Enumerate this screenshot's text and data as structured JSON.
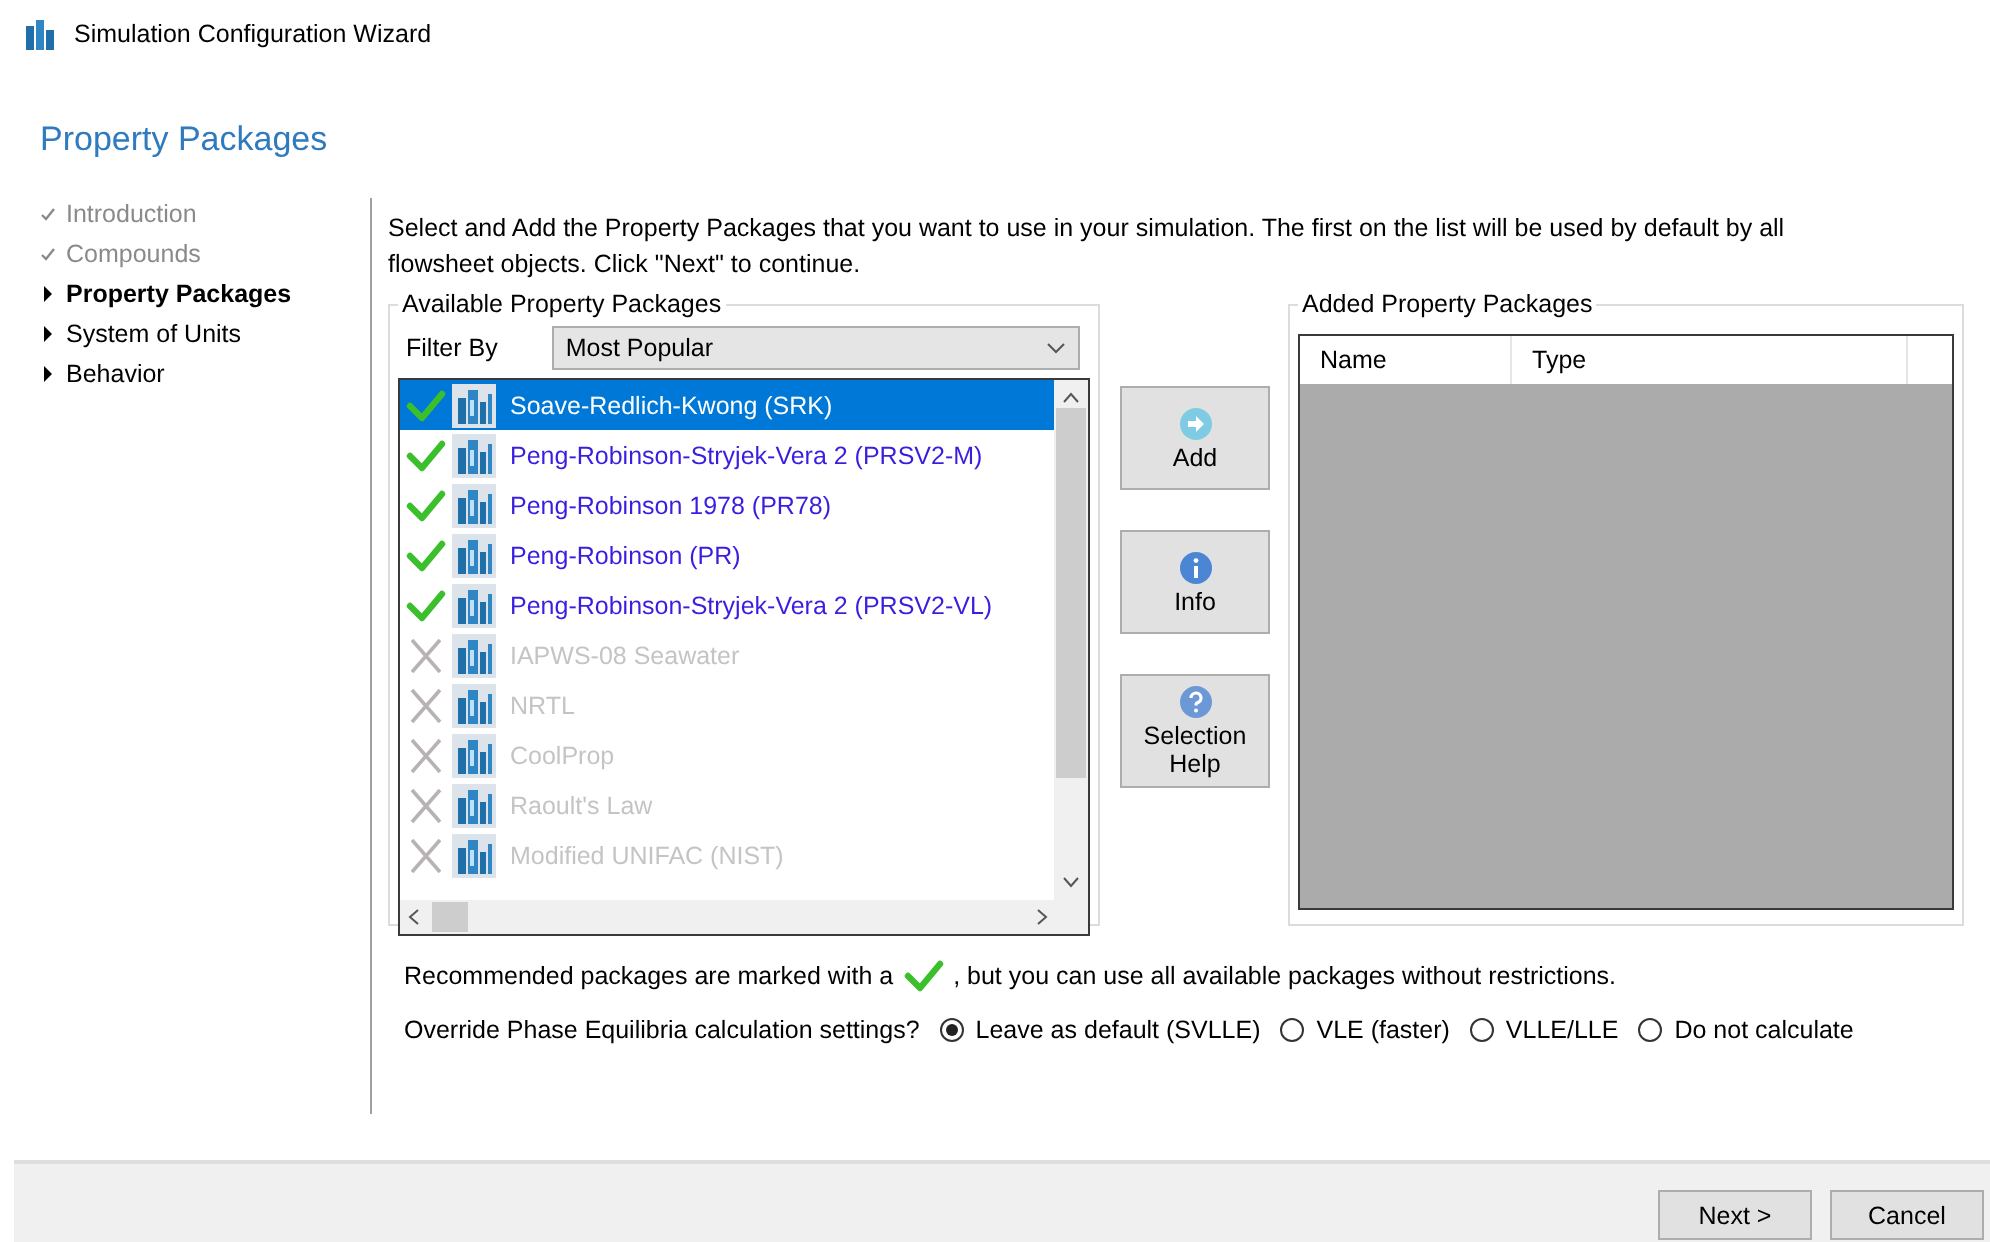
{
  "window": {
    "title": "Simulation Configuration Wizard"
  },
  "heading": "Property Packages",
  "steps": [
    {
      "label": "Introduction",
      "completed": true,
      "selected": false
    },
    {
      "label": "Compounds",
      "completed": true,
      "selected": false
    },
    {
      "label": "Property Packages",
      "completed": false,
      "selected": true
    },
    {
      "label": "System of Units",
      "completed": false,
      "selected": false
    },
    {
      "label": "Behavior",
      "completed": false,
      "selected": false
    }
  ],
  "description": "Select and Add the Property Packages that you want to use in your simulation. The first on the list will be used by default by all flowsheet objects. Click \"Next\" to continue.",
  "available": {
    "title": "Available Property Packages",
    "filter_label": "Filter By",
    "filter_value": "Most Popular",
    "packages": [
      {
        "name": "Soave-Redlich-Kwong (SRK)",
        "recommended": true,
        "selected": true
      },
      {
        "name": "Peng-Robinson-Stryjek-Vera 2 (PRSV2-M)",
        "recommended": true,
        "selected": false
      },
      {
        "name": "Peng-Robinson 1978 (PR78)",
        "recommended": true,
        "selected": false
      },
      {
        "name": "Peng-Robinson (PR)",
        "recommended": true,
        "selected": false
      },
      {
        "name": "Peng-Robinson-Stryjek-Vera 2 (PRSV2-VL)",
        "recommended": true,
        "selected": false
      },
      {
        "name": "IAPWS-08 Seawater",
        "recommended": false,
        "selected": false
      },
      {
        "name": "NRTL",
        "recommended": false,
        "selected": false
      },
      {
        "name": "CoolProp",
        "recommended": false,
        "selected": false
      },
      {
        "name": "Raoult's Law",
        "recommended": false,
        "selected": false
      },
      {
        "name": "Modified UNIFAC (NIST)",
        "recommended": false,
        "selected": false
      }
    ]
  },
  "actions": [
    {
      "kind": "add",
      "label": "Add"
    },
    {
      "kind": "info",
      "label": "Info"
    },
    {
      "kind": "help",
      "label": "Selection Help"
    }
  ],
  "added": {
    "title": "Added Property Packages",
    "columns": [
      "Name",
      "Type"
    ]
  },
  "recommendation_note": {
    "before": "Recommended packages are marked with a",
    "after": ", but you can use all available packages without restrictions."
  },
  "phase_equilibria": {
    "label": "Override Phase Equilibria calculation settings?",
    "options": [
      {
        "label": "Leave as default (SVLLE)",
        "selected": true
      },
      {
        "label": "VLE (faster)",
        "selected": false
      },
      {
        "label": "VLLE/LLE",
        "selected": false
      },
      {
        "label": "Do not calculate",
        "selected": false
      }
    ]
  },
  "buttons": [
    "Next >",
    "Cancel"
  ]
}
